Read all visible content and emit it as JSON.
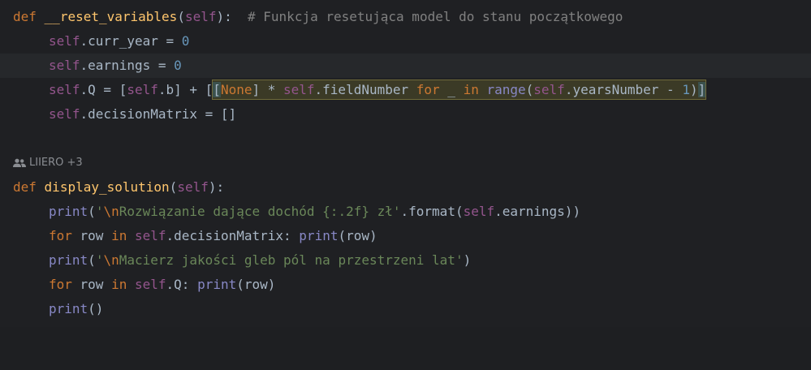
{
  "code_lines": [
    {
      "id": "line-1",
      "def_kw": "def",
      "name": "__reset_variables",
      "open": "(",
      "param": "self",
      "close": "):",
      "comment": "# Funkcja resetująca model do stanu początkowego"
    },
    {
      "id": "line-2",
      "self": "self",
      "rest": ".curr_year = ",
      "num": "0"
    },
    {
      "id": "line-3",
      "self": "self",
      "rest": ".earnings = ",
      "num": "0"
    },
    {
      "id": "line-4",
      "self1": "self",
      "part1": ".Q = [",
      "self2": "self",
      "part2": ".b] + [",
      "bracket": "[",
      "none": "None",
      "part3": "] * ",
      "self3": "self",
      "part4": ".fieldNumber ",
      "for_kw": "for",
      "underscore": " _ ",
      "in_kw": "in",
      "range_fn": " range",
      "part5": "(",
      "self4": "self",
      "part6": ".yearsNumber - ",
      "num": "1",
      "part7": ")",
      "bracket_close": "]"
    },
    {
      "id": "line-5",
      "self": "self",
      "rest": ".decisionMatrix = []"
    },
    {
      "id": "line-7",
      "def_kw": "def",
      "name": "display_solution",
      "open": "(",
      "param": "self",
      "close": "):"
    },
    {
      "id": "line-8",
      "print": "print",
      "open": "(",
      "q1": "'",
      "esc": "\\n",
      "str": "Rozwiązanie dające dochód {:.2f} zł",
      "q2": "'",
      "mid": ".format(",
      "self": "self",
      "end": ".earnings))"
    },
    {
      "id": "line-9",
      "for_kw": "for",
      "row": " row ",
      "in_kw": "in",
      "sp": " ",
      "self": "self",
      "attr": ".decisionMatrix",
      "colon": ":",
      "sp2": " ",
      "print": "print",
      "end": "(row)"
    },
    {
      "id": "line-10",
      "print": "print",
      "open": "(",
      "q1": "'",
      "esc": "\\n",
      "str": "Macierz jakości gleb pól na przestrzeni lat",
      "q2": "'",
      "end": ")"
    },
    {
      "id": "line-11",
      "for_kw": "for",
      "row": " row ",
      "in_kw": "in",
      "sp": " ",
      "self": "self",
      "attr": ".Q",
      "colon": ":",
      "sp2": " ",
      "print": "print",
      "end": "(row)"
    },
    {
      "id": "line-12",
      "print": "print",
      "end": "()"
    }
  ],
  "author_hint": {
    "icon": "people-icon",
    "text": "LIIERO +3"
  },
  "colors": {
    "background": "#1f2023",
    "keyword": "#cc7832",
    "function": "#ffc66d",
    "self": "#94558d",
    "number": "#6897bb",
    "string": "#6a8759",
    "comment": "#808080",
    "builtin": "#8888c6",
    "text": "#a9b7c6"
  }
}
